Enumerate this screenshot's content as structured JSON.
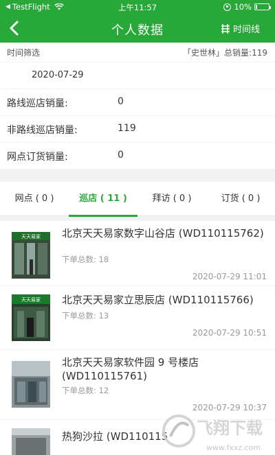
{
  "status_bar": {
    "back_app": "TestFlight",
    "time": "上午11:57",
    "battery": "10%",
    "battery_level": 0.1
  },
  "nav": {
    "title": "个人数据",
    "right_label": "时间线"
  },
  "filter": {
    "label": "时间筛选",
    "right_text": "「史世林」总销量:119",
    "date": "2020-07-29"
  },
  "stats": [
    {
      "label": "路线巡店销量:",
      "value": "0"
    },
    {
      "label": "非路线巡店销量:",
      "value": "119"
    },
    {
      "label": "网点订货销量:",
      "value": "0"
    }
  ],
  "tabs": [
    {
      "label": "网点 ( 0 )",
      "active": false
    },
    {
      "label": "巡店 ( 11 )",
      "active": true
    },
    {
      "label": "拜访 ( 0 )",
      "active": false
    },
    {
      "label": "订货 ( 0 )",
      "active": false
    }
  ],
  "stores": [
    {
      "title": "北京天天易家数字山谷店 (WD110115762)",
      "count_label": "下单总数:",
      "count": "18",
      "time": "2020-07-29 11:01",
      "sign_text": "天天易家"
    },
    {
      "title": "北京天天易家立思辰店 (WD110115766)",
      "count_label": "下单总数:",
      "count": "13",
      "time": "2020-07-29 10:51",
      "sign_text": "天天易家"
    },
    {
      "title": "北京天天易家软件园 9 号楼店 (WD110115761)",
      "count_label": "下单总数:",
      "count": "12",
      "time": "2020-07-29 10:37",
      "sign_text": ""
    },
    {
      "title": "热狗沙拉 (WD110115",
      "count_label": "",
      "count": "",
      "time": "",
      "sign_text": ""
    }
  ],
  "watermark": {
    "text": "飞翔下载",
    "url": "www.fxxz.com"
  },
  "colors": {
    "accent": "#29a83a",
    "background": "#f2f2f2"
  }
}
